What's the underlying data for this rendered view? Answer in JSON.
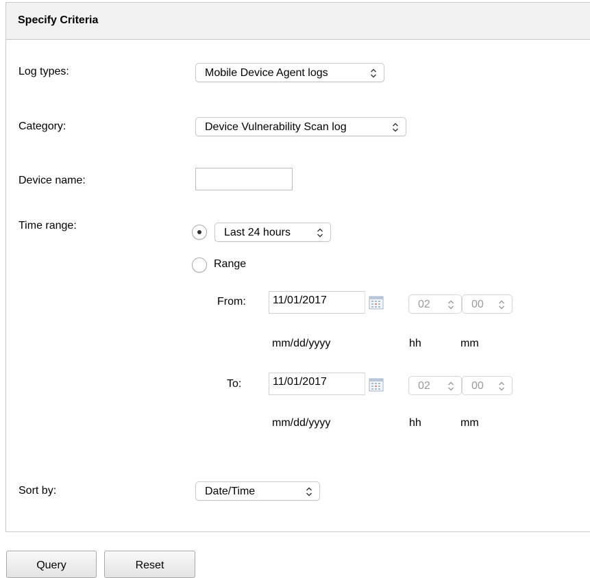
{
  "panel": {
    "title": "Specify Criteria"
  },
  "form": {
    "log_types": {
      "label": "Log types:",
      "value": "Mobile Device Agent logs"
    },
    "category": {
      "label": "Category:",
      "value": "Device Vulnerability Scan log"
    },
    "device_name": {
      "label": "Device name:",
      "value": ""
    },
    "time_range": {
      "label": "Time range:",
      "preset_option": {
        "selected": true,
        "value": "Last 24 hours"
      },
      "range_option": {
        "selected": false,
        "label": "Range"
      },
      "from": {
        "label": "From:",
        "date": "11/01/2017",
        "date_format": "mm/dd/yyyy",
        "hour": "02",
        "minute": "00",
        "hour_label": "hh",
        "minute_label": "mm"
      },
      "to": {
        "label": "To:",
        "date": "11/01/2017",
        "date_format": "mm/dd/yyyy",
        "hour": "02",
        "minute": "00",
        "hour_label": "hh",
        "minute_label": "mm"
      }
    },
    "sort_by": {
      "label": "Sort by:",
      "value": "Date/Time"
    }
  },
  "buttons": {
    "query": "Query",
    "reset": "Reset"
  },
  "icons": {
    "select_chevron": "chevron-up-down-icon",
    "calendar": "calendar-icon"
  }
}
